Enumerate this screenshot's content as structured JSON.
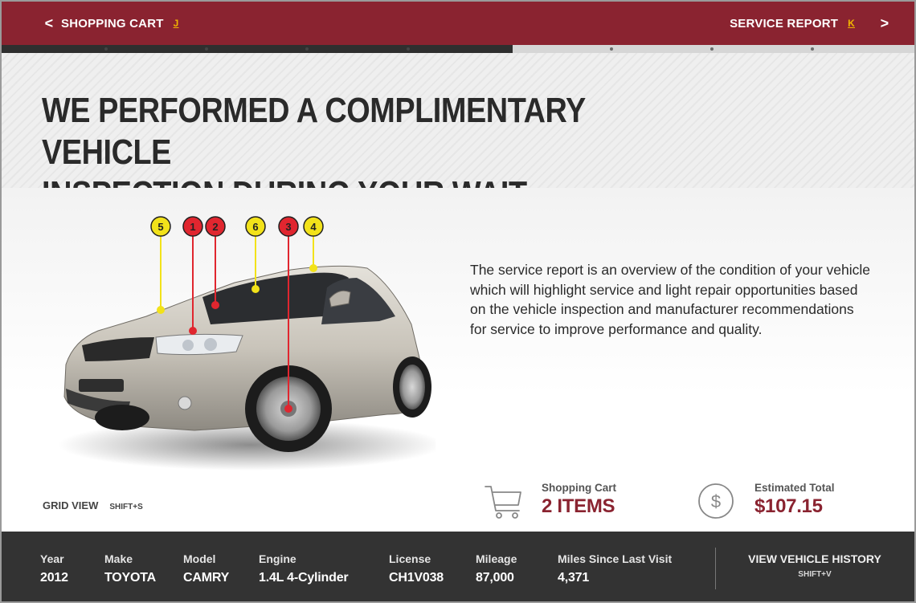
{
  "nav": {
    "prev_label": "SHOPPING CART",
    "prev_hotkey": "J",
    "next_label": "SERVICE REPORT",
    "next_hotkey": "K",
    "prev_chevron": "<",
    "next_chevron": ">"
  },
  "progress": {
    "completed_fraction": 0.56
  },
  "headline": {
    "line1": "WE PERFORMED A COMPLIMENTARY VEHICLE",
    "line2": "INSPECTION DURING YOUR WAIT"
  },
  "inspection_markers": [
    {
      "number": "5",
      "status": "yellow"
    },
    {
      "number": "1",
      "status": "red"
    },
    {
      "number": "2",
      "status": "red"
    },
    {
      "number": "6",
      "status": "yellow"
    },
    {
      "number": "3",
      "status": "red"
    },
    {
      "number": "4",
      "status": "yellow"
    }
  ],
  "description": "The service report is an overview of the condition of your vehicle which will highlight service and light repair opportunities based on the vehicle inspection and manufacturer recommendations for service to improve performance and quality.",
  "grid_view": {
    "label": "GRID VIEW",
    "hotkey": "SHIFT+S"
  },
  "cart": {
    "caption": "Shopping Cart",
    "value": "2 ITEMS",
    "icon": "cart-icon"
  },
  "total": {
    "caption": "Estimated Total",
    "value": "$107.15",
    "icon": "dollar-circle-icon"
  },
  "vehicle": {
    "year_label": "Year",
    "year": "2012",
    "make_label": "Make",
    "make": "TOYOTA",
    "model_label": "Model",
    "model": "CAMRY",
    "engine_label": "Engine",
    "engine": "1.4L 4-Cylinder",
    "license_label": "License",
    "license": "CH1V038",
    "mileage_label": "Mileage",
    "mileage": "87,000",
    "since_label": "Miles Since Last Visit",
    "since": "4,371"
  },
  "history": {
    "label": "VIEW VEHICLE HISTORY",
    "hotkey": "SHIFT+V"
  },
  "colors": {
    "brand": "#8a2330",
    "marker_red": "#e0262f",
    "marker_yellow": "#f2e21a",
    "hotkey": "#f0b400",
    "bottom_bar": "#333333"
  }
}
